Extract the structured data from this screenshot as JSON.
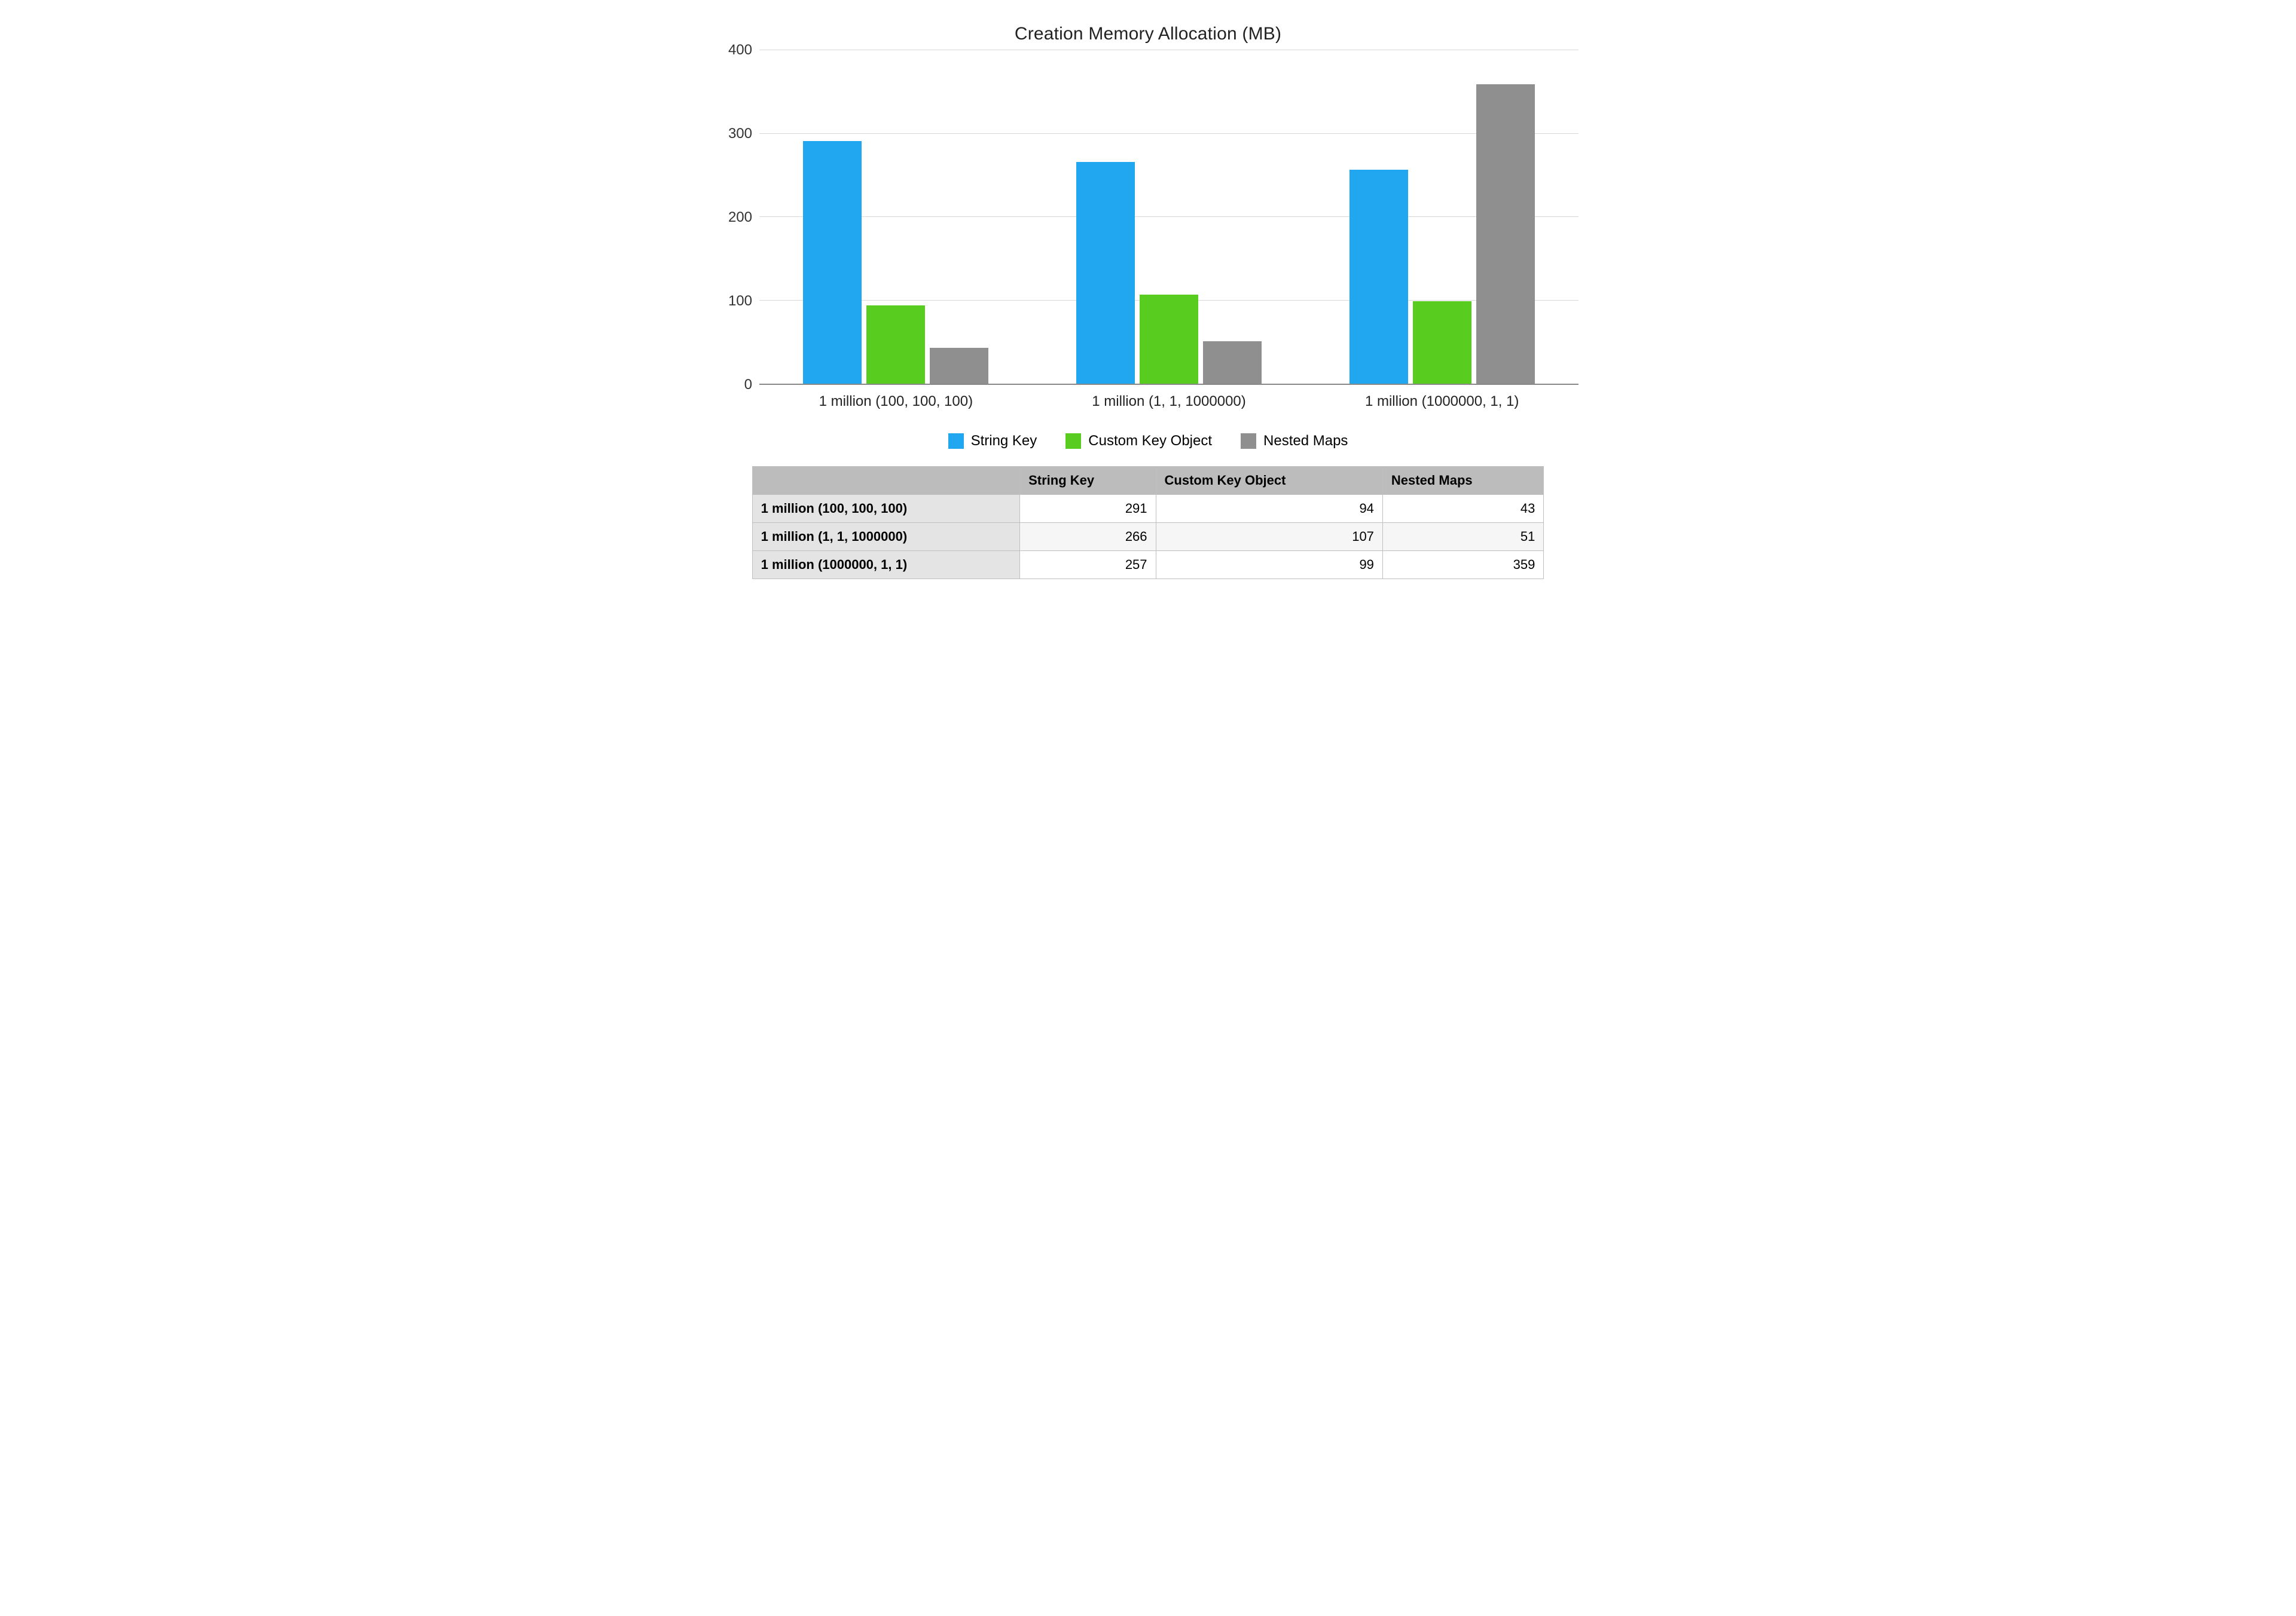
{
  "chart_data": {
    "type": "bar",
    "title": "Creation Memory Allocation (MB)",
    "ylabel": "",
    "xlabel": "",
    "ylim": [
      0,
      400
    ],
    "yticks": [
      0,
      100,
      200,
      300,
      400
    ],
    "categories": [
      "1 million (100, 100, 100)",
      "1 million (1, 1, 1000000)",
      "1 million (1000000, 1, 1)"
    ],
    "series": [
      {
        "name": "String Key",
        "color": "#20a7ef",
        "values": [
          291,
          266,
          257
        ]
      },
      {
        "name": "Custom Key Object",
        "color": "#58cc1f",
        "values": [
          94,
          107,
          99
        ]
      },
      {
        "name": "Nested Maps",
        "color": "#8f8f8f",
        "values": [
          43,
          51,
          359
        ]
      }
    ]
  },
  "table": {
    "corner": "",
    "col_headers": [
      "String Key",
      "Custom Key Object",
      "Nested Maps"
    ],
    "rows": [
      {
        "label": "1 million (100, 100, 100)",
        "cells": [
          291,
          94,
          43
        ]
      },
      {
        "label": "1 million (1, 1, 1000000)",
        "cells": [
          266,
          107,
          51
        ]
      },
      {
        "label": "1 million (1000000, 1, 1)",
        "cells": [
          257,
          99,
          359
        ]
      }
    ]
  }
}
